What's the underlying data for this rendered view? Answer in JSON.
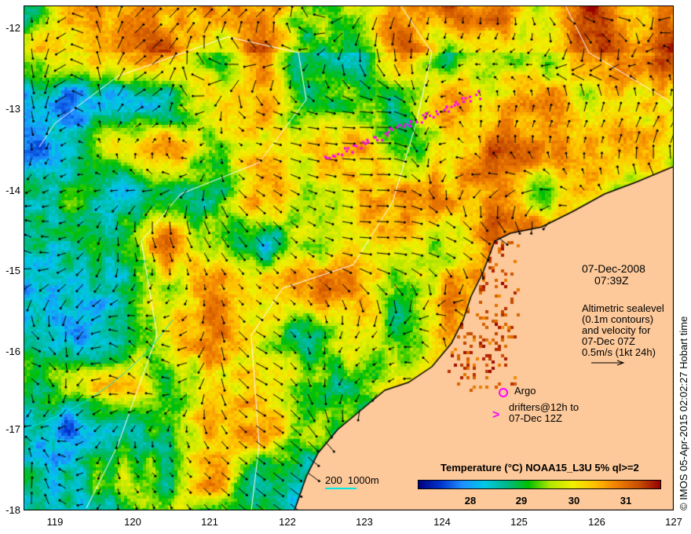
{
  "axes": {
    "x_ticks": [
      "119",
      "120",
      "121",
      "122",
      "123",
      "124",
      "125",
      "126",
      "127"
    ],
    "y_ticks": [
      "-12",
      "-13",
      "-14",
      "-15",
      "-16",
      "-17",
      "-18"
    ]
  },
  "info": {
    "date": "07-Dec-2008",
    "time": "07:39Z",
    "altimetry_lines": [
      "Altimetric sealevel",
      "(0.1m contours)",
      "and velocity for",
      "07-Dec 07Z",
      "0.5m/s (1kt 24h)"
    ],
    "argo_label": "Argo",
    "drifters_lines": [
      "drifters@12h to",
      "07-Dec 12Z"
    ],
    "drifter_symbol": ">",
    "bathymetry_label": "200  1000m"
  },
  "colorbar": {
    "title": "Temperature (°C) NOAA15_L3U 5% ql>=2",
    "ticks": [
      "28",
      "29",
      "30",
      "31"
    ],
    "range": [
      27.0,
      31.7
    ]
  },
  "credit": "© IMOS 05-Apr-2015 02:02:27 Hobart time",
  "colors": {
    "land": "#fdc99a",
    "marker": "#ff00ff",
    "bathy": "#00e5e5"
  }
}
